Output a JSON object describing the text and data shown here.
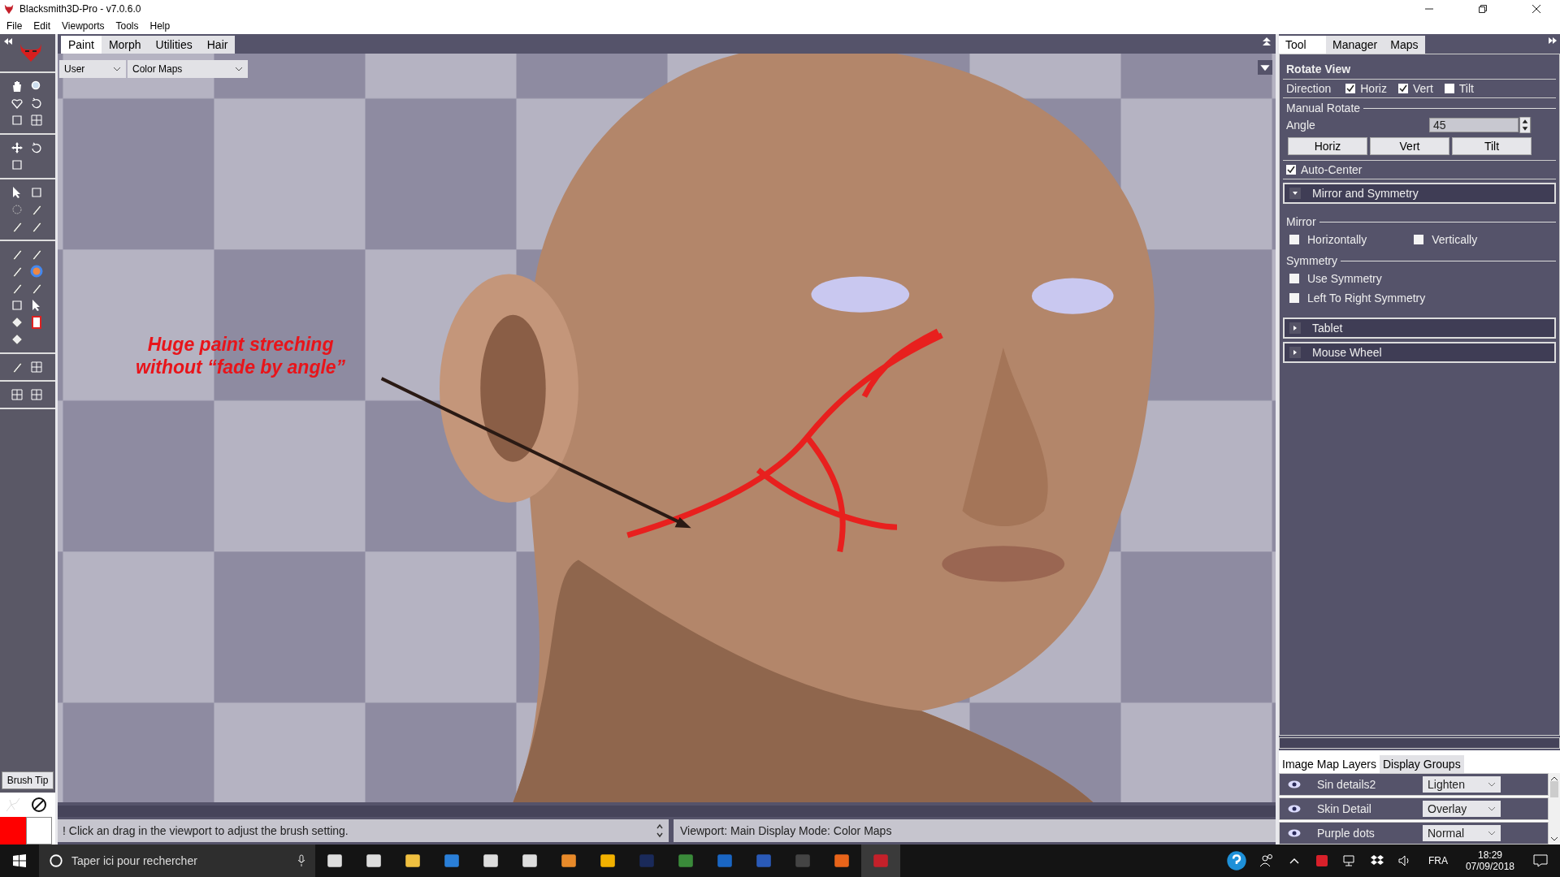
{
  "window": {
    "title": "Blacksmith3D-Pro - v7.0.6.0"
  },
  "menu": [
    "File",
    "Edit",
    "Viewports",
    "Tools",
    "Help"
  ],
  "toolbar": {
    "brush_tip": "Brush Tip"
  },
  "viewport_tabs": [
    {
      "label": "Paint",
      "selected": true
    },
    {
      "label": "Morph",
      "selected": false
    },
    {
      "label": "Utilities",
      "selected": false
    },
    {
      "label": "Hair",
      "selected": false
    }
  ],
  "dropdowns": [
    "User",
    "Color Maps"
  ],
  "viewport": {
    "annotation": [
      "Huge paint streching",
      "without “fade by angle”"
    ]
  },
  "status": {
    "message": "! Click an drag in the viewport to adjust the brush setting.",
    "viewport_info": "Viewport: Main Display Mode: Color Maps"
  },
  "panel_tabs": [
    {
      "label": "Tool",
      "selected": true
    },
    {
      "label": "Manager",
      "selected": false
    },
    {
      "label": "Maps",
      "selected": false
    }
  ],
  "rotate_view": {
    "title": "Rotate View",
    "direction_label": "Direction",
    "directions": [
      {
        "label": "Horiz",
        "checked": true
      },
      {
        "label": "Vert",
        "checked": true
      },
      {
        "label": "Tilt",
        "checked": false
      }
    ],
    "manual_rotate": "Manual Rotate",
    "angle_label": "Angle",
    "angle": "45",
    "buttons": [
      "Horiz",
      "Vert",
      "Tilt"
    ],
    "auto_center": {
      "label": "Auto-Center",
      "checked": true
    }
  },
  "sections": [
    {
      "label": "Mirror and Symmetry",
      "expanded": true,
      "groups": [
        {
          "label": "Mirror",
          "options": [
            {
              "label": "Horizontally",
              "checked": false
            },
            {
              "label": "Vertically",
              "checked": false
            }
          ]
        },
        {
          "label": "Symmetry",
          "options": [
            {
              "label": "Use Symmetry",
              "checked": false
            },
            {
              "label": "Left To Right Symmetry",
              "checked": false
            }
          ]
        }
      ]
    },
    {
      "label": "Tablet",
      "expanded": false
    },
    {
      "label": "Mouse Wheel",
      "expanded": false
    }
  ],
  "layer_tabs": [
    {
      "label": "Image Map Layers",
      "selected": true
    },
    {
      "label": "Display Groups",
      "selected": false
    }
  ],
  "layers": [
    {
      "name": "Sin details2",
      "blend": "Lighten"
    },
    {
      "name": "Skin Detail",
      "blend": "Overlay"
    },
    {
      "name": "Purple dots",
      "blend": "Normal"
    }
  ],
  "taskbar": {
    "search_placeholder": "Taper ici pour rechercher",
    "language": "FRA",
    "time": "18:29",
    "date": "07/09/2018"
  }
}
